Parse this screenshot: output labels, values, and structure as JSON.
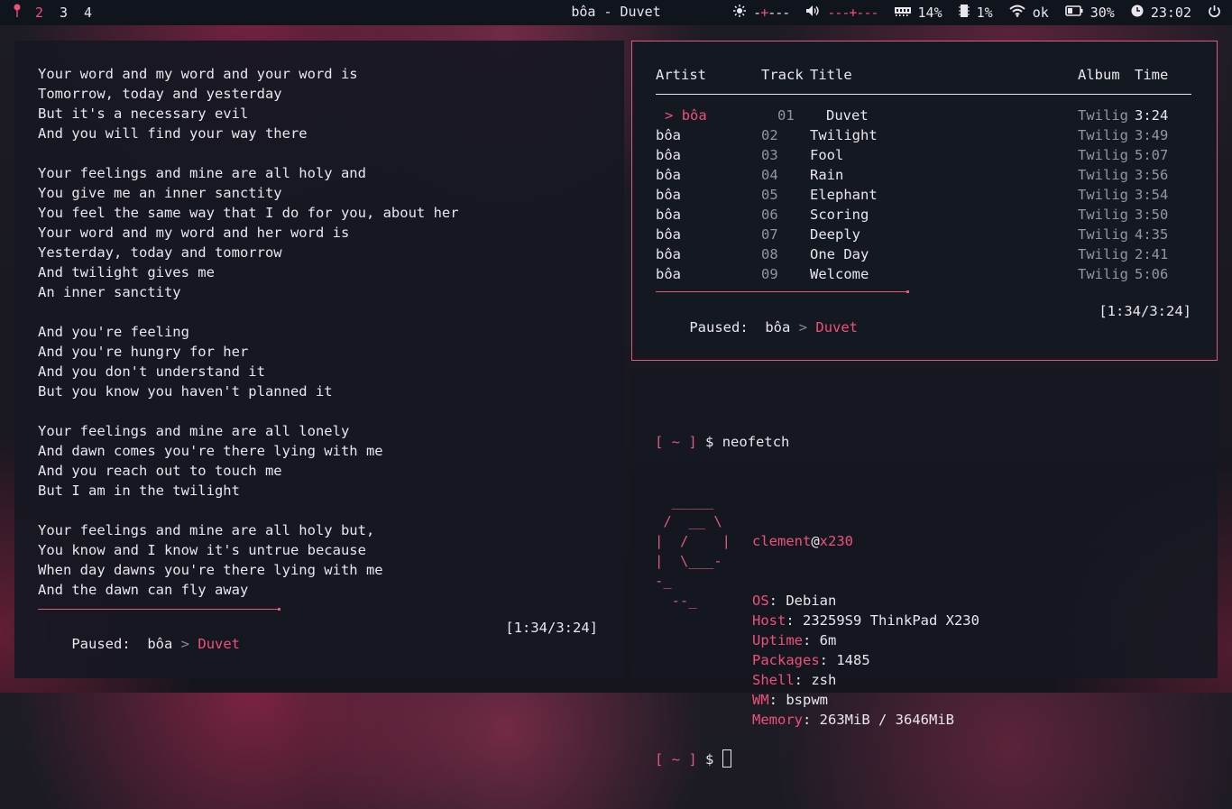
{
  "topbar": {
    "workspaces": [
      "2",
      "3",
      "4"
    ],
    "window_title": "bôa - Duvet",
    "brightness_slider": "-+---",
    "volume_slider": "---+---",
    "ram": "14%",
    "cpu": "1%",
    "wifi": "ok",
    "battery": "30%",
    "clock": "23:02",
    "icons": [
      "pin-icon",
      "brightness-icon",
      "volume-icon",
      "ram-icon",
      "cpu-icon",
      "wifi-icon",
      "battery-icon",
      "clock-icon",
      "power-icon"
    ]
  },
  "lyrics": {
    "lines": [
      "Your word and my word and your word is",
      "Tomorrow, today and yesterday",
      "But it's a necessary evil",
      "And you will find your way there",
      "",
      "Your feelings and mine are all holy and",
      "You give me an inner sanctity",
      "You feel the same way that I do for you, about her",
      "Your word and my word and her word is",
      "Yesterday, today and tomorrow",
      "And twilight gives me",
      "An inner sanctity",
      "",
      "And you're feeling",
      "And you're hungry for her",
      "And you don't understand it",
      "But you know you haven't planned it",
      "",
      "Your feelings and mine are all lonely",
      "And dawn comes you're there lying with me",
      "And you reach out to touch me",
      "But I am in the twilight",
      "",
      "Your feelings and mine are all holy but,",
      "You know and I know it's untrue because",
      "When day dawns you're there lying with me",
      "And the dawn can fly away"
    ],
    "progress": 0.43
  },
  "player": {
    "status": "Paused:",
    "artist": "bôa",
    "separator": ">",
    "title": "Duvet",
    "elapsed": "[1:34/3:24]"
  },
  "playlist": {
    "headers": {
      "artist": "Artist",
      "track": "Track",
      "title": "Title",
      "album": "Album",
      "time": "Time"
    },
    "current_prefix": ">",
    "rows": [
      {
        "artist": "bôa",
        "track": "01",
        "title": "Duvet",
        "album": "Twilig",
        "time": "3:24"
      },
      {
        "artist": "bôa",
        "track": "02",
        "title": "Twilight",
        "album": "Twilig",
        "time": "3:49"
      },
      {
        "artist": "bôa",
        "track": "03",
        "title": "Fool",
        "album": "Twilig",
        "time": "5:07"
      },
      {
        "artist": "bôa",
        "track": "04",
        "title": "Rain",
        "album": "Twilig",
        "time": "3:56"
      },
      {
        "artist": "bôa",
        "track": "05",
        "title": "Elephant",
        "album": "Twilig",
        "time": "3:54"
      },
      {
        "artist": "bôa",
        "track": "06",
        "title": "Scoring",
        "album": "Twilig",
        "time": "3:50"
      },
      {
        "artist": "bôa",
        "track": "07",
        "title": "Deeply",
        "album": "Twilig",
        "time": "4:35"
      },
      {
        "artist": "bôa",
        "track": "08",
        "title": "One Day",
        "album": "Twilig",
        "time": "2:41"
      },
      {
        "artist": "bôa",
        "track": "09",
        "title": "Welcome",
        "album": "Twilig",
        "time": "5:06"
      }
    ],
    "progress": 0.47
  },
  "terminal": {
    "prompt": "[ ~ ]",
    "dollar": "$",
    "command": "neofetch",
    "logo": [
      "  _____",
      " /  __ \\",
      "|  /    |",
      "|  \\___-",
      "-_",
      "  --_"
    ],
    "user": "clement",
    "at": "@",
    "host": "x230",
    "info": [
      {
        "key": "OS",
        "value": "Debian"
      },
      {
        "key": "Host",
        "value": "23259S9 ThinkPad X230"
      },
      {
        "key": "Uptime",
        "value": "6m"
      },
      {
        "key": "Packages",
        "value": "1485"
      },
      {
        "key": "Shell",
        "value": "zsh"
      },
      {
        "key": "WM",
        "value": "bspwm"
      },
      {
        "key": "Memory",
        "value": "263MiB / 3646MiB"
      }
    ]
  },
  "colors": {
    "accent": "#f0507a",
    "border": "#e05a80",
    "text": "#e9e6ef",
    "dim": "#9694a3"
  }
}
